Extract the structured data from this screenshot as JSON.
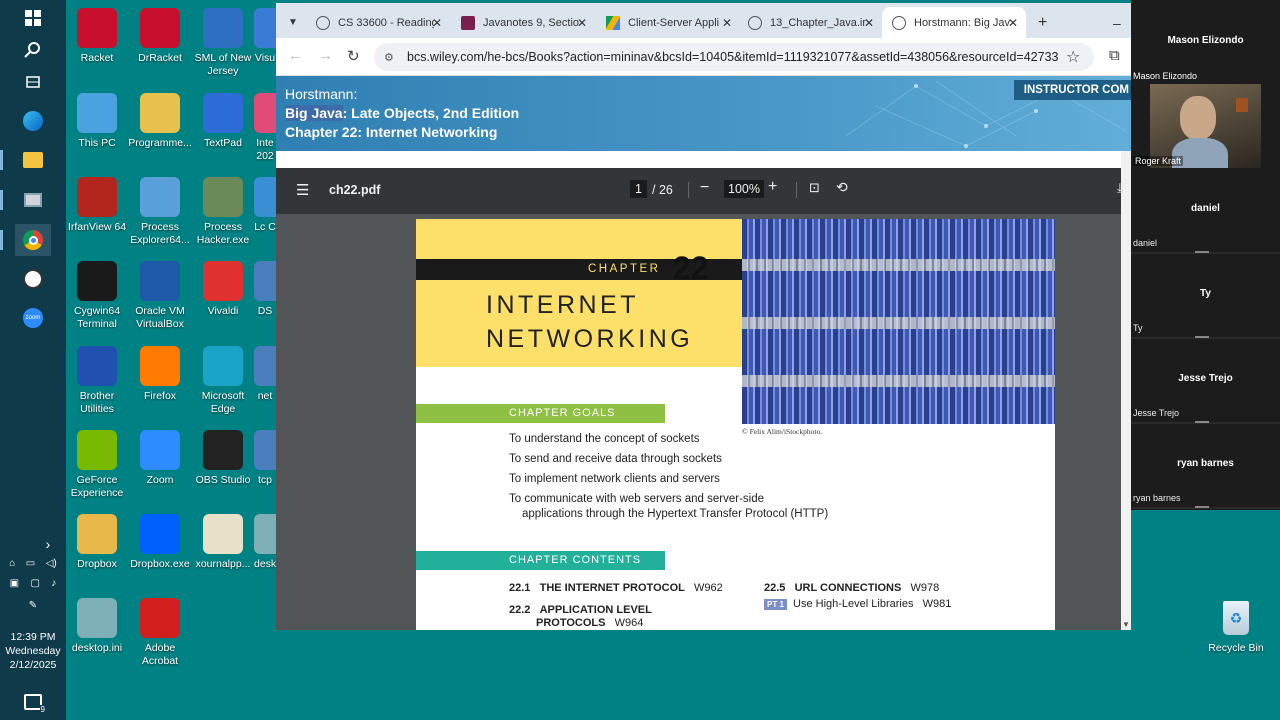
{
  "taskbar": {
    "time": "12:39 PM",
    "day": "Wednesday",
    "date": "2/12/2025",
    "notifications": "9"
  },
  "desktop_icons": [
    {
      "label": "Racket",
      "icon": "racket-icon",
      "color": "#c8102e"
    },
    {
      "label": "DrRacket",
      "icon": "drracket-icon",
      "color": "#c8102e"
    },
    {
      "label": "SML of New Jersey",
      "icon": "smlnj-icon",
      "color": "#2f6fc2"
    },
    {
      "label": "Visu",
      "icon": "visual-studio-icon",
      "color": "#3a7bd5"
    },
    {
      "label": "This PC",
      "icon": "this-pc-icon",
      "color": "#4aa3df"
    },
    {
      "label": "Programme...",
      "icon": "notepad-icon",
      "color": "#e6c14b"
    },
    {
      "label": "TextPad",
      "icon": "textpad-icon",
      "color": "#2d6bd6"
    },
    {
      "label": "Inte 202",
      "icon": "intellij-icon",
      "color": "#e04b77"
    },
    {
      "label": "IrfanView 64",
      "icon": "irfanview-icon",
      "color": "#b3261e"
    },
    {
      "label": "Process Explorer64...",
      "icon": "process-explorer-icon",
      "color": "#5aa0d8"
    },
    {
      "label": "Process Hacker.exe",
      "icon": "process-hacker-icon",
      "color": "#6a8a5a"
    },
    {
      "label": "Lc C",
      "icon": "app-icon",
      "color": "#3a8fd4"
    },
    {
      "label": "Cygwin64 Terminal",
      "icon": "cygwin-icon",
      "color": "#1a1a1a"
    },
    {
      "label": "Oracle VM VirtualBox",
      "icon": "virtualbox-icon",
      "color": "#1e5aa8"
    },
    {
      "label": "Vivaldi",
      "icon": "vivaldi-icon",
      "color": "#e03131"
    },
    {
      "label": "DS",
      "icon": "ds-icon",
      "color": "#4a7fbf"
    },
    {
      "label": "Brother Utilities",
      "icon": "brother-icon",
      "color": "#2050b0"
    },
    {
      "label": "Firefox",
      "icon": "firefox-icon",
      "color": "#ff7a00"
    },
    {
      "label": "Microsoft Edge",
      "icon": "edge-icon",
      "color": "#1aa3c8"
    },
    {
      "label": "net",
      "icon": "net-icon",
      "color": "#4a7fbf"
    },
    {
      "label": "GeForce Experience",
      "icon": "geforce-icon",
      "color": "#76b900"
    },
    {
      "label": "Zoom",
      "icon": "zoom-icon",
      "color": "#2d8cff"
    },
    {
      "label": "OBS Studio",
      "icon": "obs-icon",
      "color": "#222222"
    },
    {
      "label": "tcp",
      "icon": "tcp-icon",
      "color": "#4a7fbf"
    },
    {
      "label": "Dropbox",
      "icon": "dropbox-folder-icon",
      "color": "#e8b84a"
    },
    {
      "label": "Dropbox.exe",
      "icon": "dropbox-icon",
      "color": "#0061fe"
    },
    {
      "label": "xournalpp...",
      "icon": "xournal-icon",
      "color": "#e8e0c8"
    },
    {
      "label": "desktop.ini",
      "icon": "ini-file-icon",
      "color": "#7fb0b8"
    },
    {
      "label": "desktop.ini",
      "icon": "ini-file-icon",
      "color": "#7fb0b8"
    },
    {
      "label": "Adobe Acrobat",
      "icon": "acrobat-icon",
      "color": "#d41f1f"
    }
  ],
  "recycle_bin": {
    "label": "Recycle Bin"
  },
  "browser": {
    "tabs": [
      {
        "title": "CS 33600 - Reading",
        "icon": "globe-icon"
      },
      {
        "title": "Javanotes 9, Sectio",
        "icon": "javanotes-icon"
      },
      {
        "title": "Client-Server Appli",
        "icon": "drive-icon"
      },
      {
        "title": "13_Chapter_Java.in",
        "icon": "globe-icon"
      },
      {
        "title": "Horstmann: Big Jav",
        "icon": "globe-icon"
      }
    ],
    "url": "bcs.wiley.com/he-bcs/Books?action=mininav&bcsId=10405&itemId=1119321077&assetId=438056&resourceId=42733",
    "banner": {
      "author": "Horstmann:",
      "book_prefix": "Big Java",
      "book_suffix": ": Late Objects, 2nd Edition",
      "chapter": "Chapter 22: Internet Networking",
      "instructor": "INSTRUCTOR COM"
    },
    "pdf": {
      "filename": "ch22.pdf",
      "page": "1",
      "total": "/ 26",
      "zoom": "100%",
      "chapter_word": "CHAPTER",
      "chapter_num": "22",
      "title_line1": "INTERNET",
      "title_line2": "NETWORKING",
      "credit": "© Felix Alim/iStockphoto.",
      "goals_header": "CHAPTER GOALS",
      "goals": [
        "To understand the concept of sockets",
        "To send and receive data through sockets",
        "To implement network clients and servers",
        "To communicate with web servers and server-side",
        "applications through the Hypertext Transfer Protocol (HTTP)"
      ],
      "contents_header": "CHAPTER CONTENTS",
      "contents": {
        "c1_num": "22.1",
        "c1_title": "THE INTERNET PROTOCOL",
        "c1_page": "W962",
        "c2_num": "22.2",
        "c2_title": "APPLICATION LEVEL",
        "c2_title2": "PROTOCOLS",
        "c2_page": "W964",
        "c5_num": "22.5",
        "c5_title": "URL CONNECTIONS",
        "c5_page": "W978",
        "pt_badge": "PT 1",
        "pt_title": "Use High-Level Libraries",
        "pt_page": "W981"
      }
    }
  },
  "zoom_panel": {
    "host": "Mason Elizondo",
    "host_label": "Mason Elizondo",
    "video_label": "Roger Kraft",
    "participants": [
      {
        "name": "daniel",
        "label": "daniel"
      },
      {
        "name": "Ty",
        "label": "Ty"
      },
      {
        "name": "Jesse Trejo",
        "label": "Jesse Trejo"
      },
      {
        "name": "ryan barnes",
        "label": "ryan barnes"
      }
    ]
  }
}
